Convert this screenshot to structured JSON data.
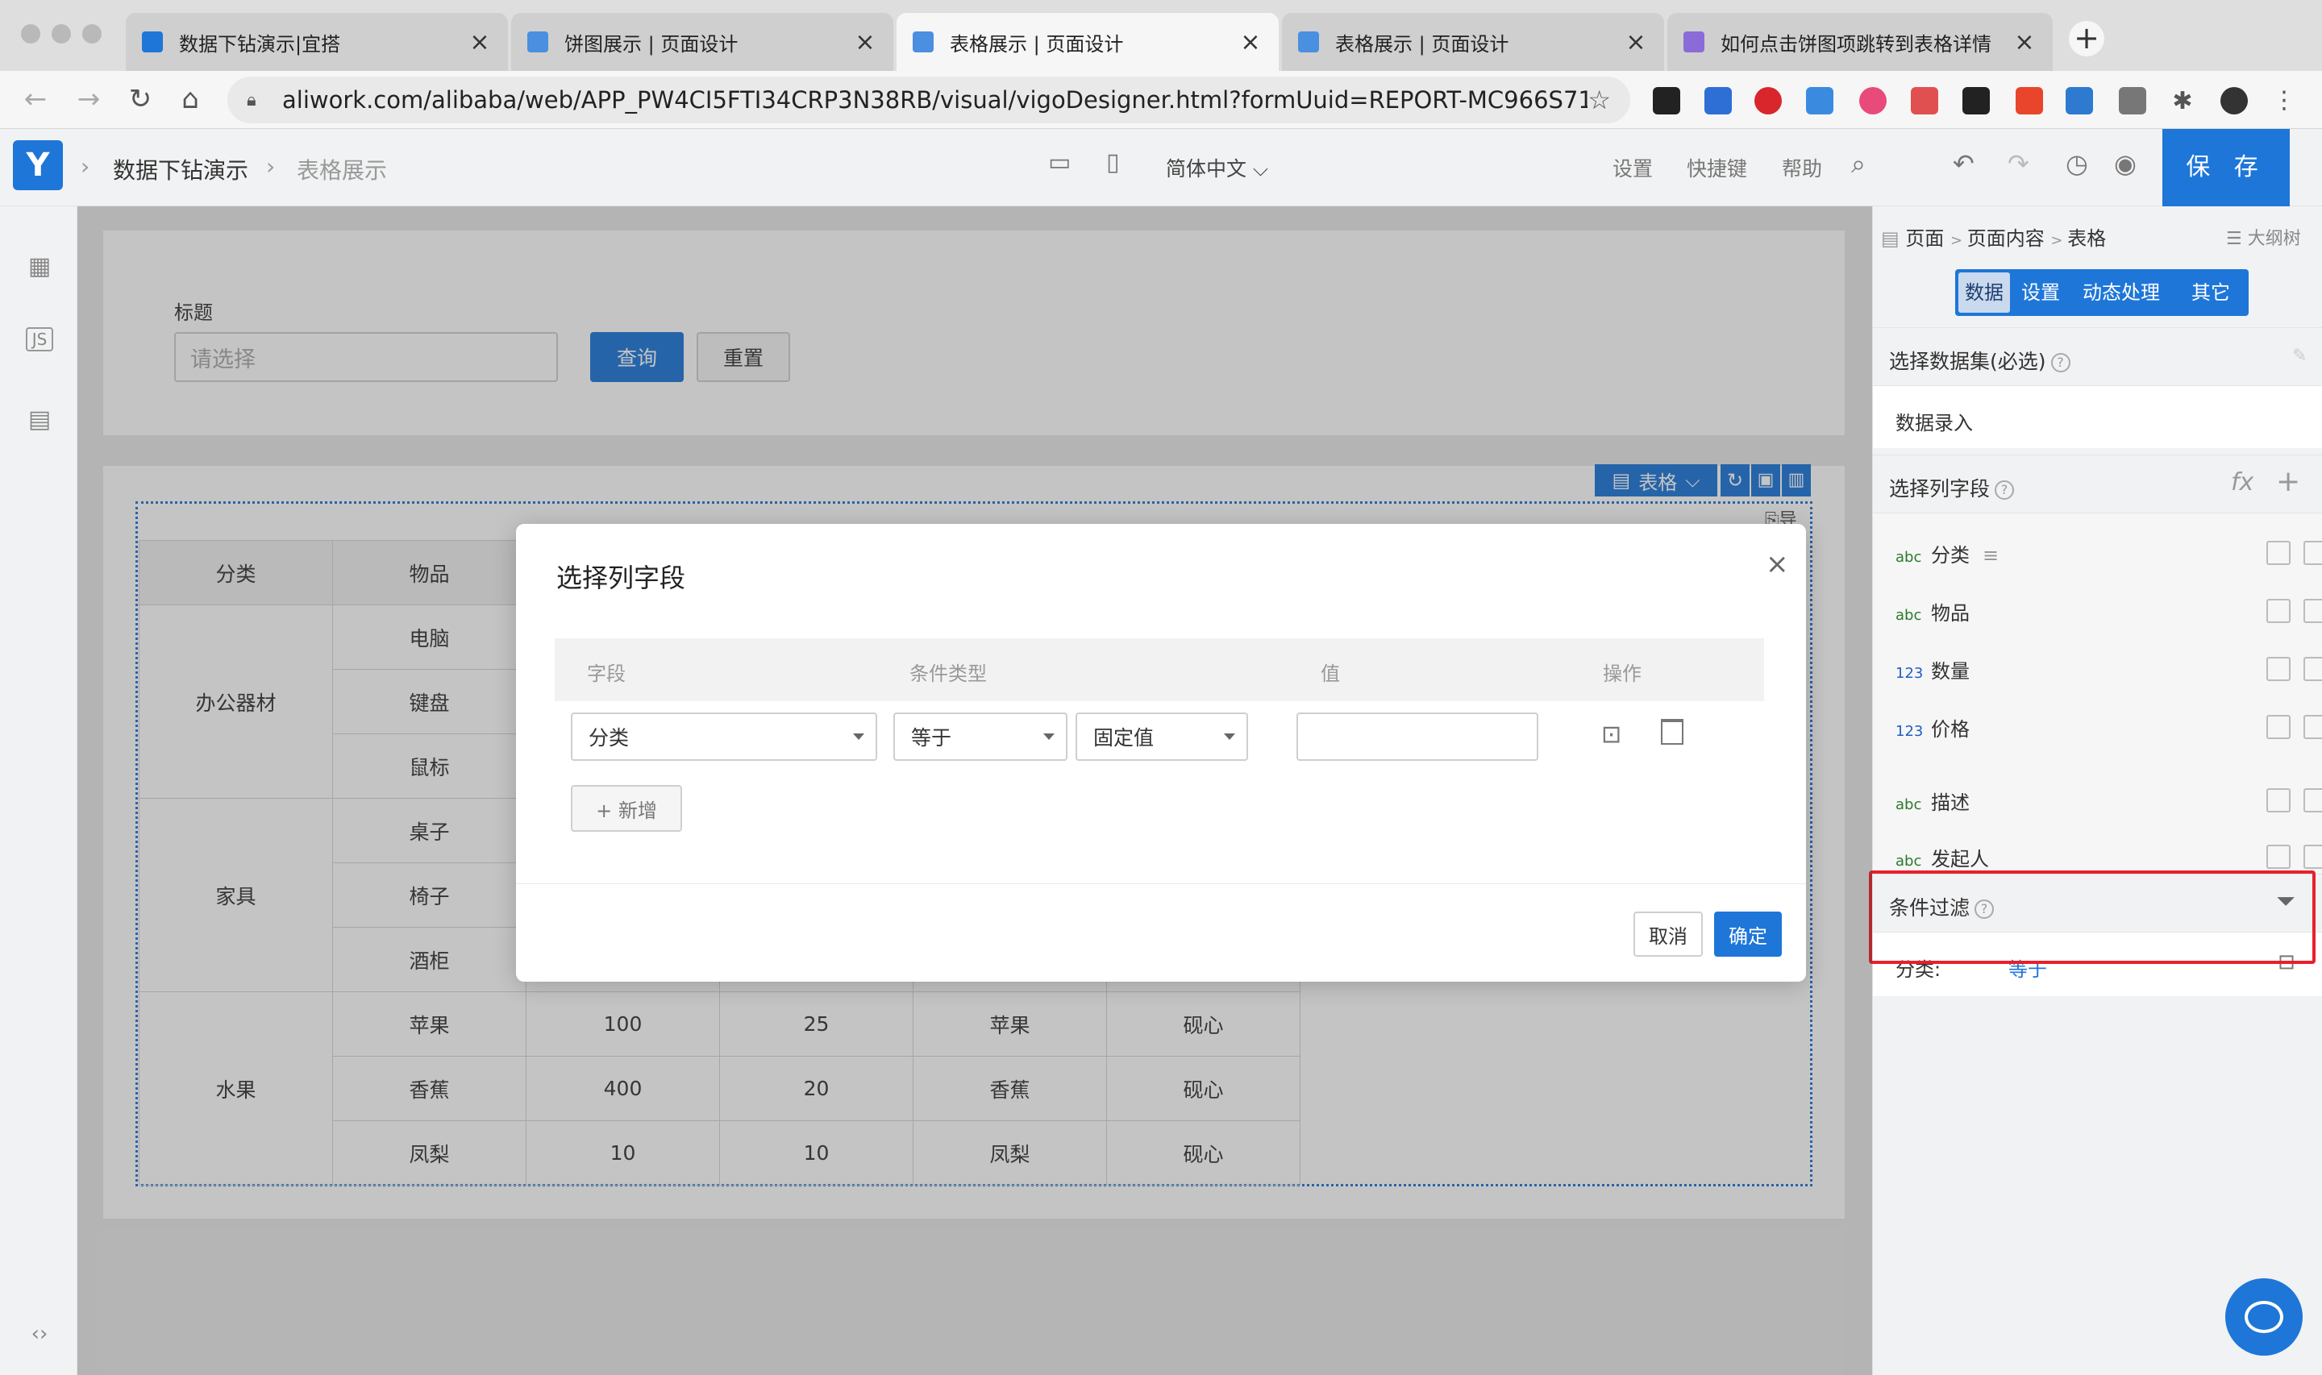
{
  "browser": {
    "tabs": [
      {
        "title": "数据下钻演示|宜搭",
        "active": false,
        "fav_color": "#1e76d8"
      },
      {
        "title": "饼图展示 | 页面设计",
        "active": false,
        "fav_color": "#4a8fe0"
      },
      {
        "title": "表格展示 | 页面设计",
        "active": true,
        "fav_color": "#4a8fe0"
      },
      {
        "title": "表格展示 | 页面设计",
        "active": false,
        "fav_color": "#4a8fe0"
      },
      {
        "title": "如何点击饼图项跳转到表格详情",
        "active": false,
        "fav_color": "#8a6bd8"
      }
    ],
    "url": "aliwork.com/alibaba/web/APP_PW4CI5FTI34CRP3N38RB/visual/vigoDesigner.html?formUuid=REPORT-MC966S71A0JOU...",
    "tab_close": "×",
    "new_tab": "+"
  },
  "header": {
    "app_name": "数据下钻演示",
    "page_name": "表格展示",
    "language": "简体中文",
    "settings": "设置",
    "shortcuts": "快捷键",
    "help": "帮助",
    "save": "保 存"
  },
  "form": {
    "title_label": "标题",
    "title_placeholder": "请选择",
    "query_btn": "查询",
    "reset_btn": "重置"
  },
  "table_widget": {
    "tag": "表格",
    "export": "导出",
    "headers": [
      "分类",
      "物品",
      "",
      "",
      "",
      ""
    ],
    "groups": [
      {
        "category": "办公器材",
        "items": [
          "电脑",
          "键盘",
          "鼠标"
        ]
      },
      {
        "category": "家具",
        "items": [
          "桌子",
          "椅子",
          "酒柜"
        ]
      },
      {
        "category": "水果",
        "items": [
          "苹果",
          "香蕉",
          "凤梨"
        ]
      }
    ],
    "fruit_rows": [
      [
        "100",
        "25",
        "苹果",
        "砚心"
      ],
      [
        "400",
        "20",
        "香蕉",
        "砚心"
      ],
      [
        "10",
        "10",
        "凤梨",
        "砚心"
      ]
    ]
  },
  "modal": {
    "title": "选择列字段",
    "close": "×",
    "col_field": "字段",
    "col_condition": "条件类型",
    "col_value": "值",
    "col_action": "操作",
    "row_field": "分类",
    "row_condition": "等于",
    "row_value_type": "固定值",
    "row_value": "",
    "add_btn": "+ 新增",
    "cancel": "取消",
    "confirm": "确定"
  },
  "right_panel": {
    "breadcrumb": [
      "页面",
      "页面内容",
      "表格"
    ],
    "outline": "大纲树",
    "tabs": [
      "数据",
      "设置",
      "动态处理",
      "其它"
    ],
    "dataset_label": "选择数据集(必选)",
    "dataset_value": "数据录入",
    "columns_label": "选择列字段",
    "fields": [
      {
        "type": "abc",
        "name": "分类"
      },
      {
        "type": "abc",
        "name": "物品"
      },
      {
        "type": "123",
        "name": "数量"
      },
      {
        "type": "123",
        "name": "价格"
      },
      {
        "type": "abc",
        "name": "描述"
      },
      {
        "type": "abc",
        "name": "发起人"
      }
    ],
    "filter_label": "条件过滤",
    "filter_field": "分类:",
    "filter_op": "等于"
  },
  "colors": {
    "primary": "#1e76d8",
    "highlight_border": "#e8202c"
  }
}
